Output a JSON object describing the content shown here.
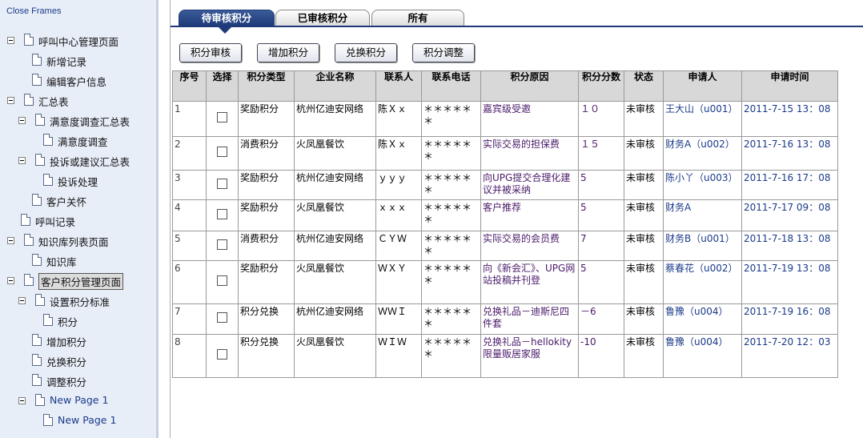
{
  "sidebar": {
    "close_frames": "Close Frames",
    "tree": [
      {
        "label": "呼叫中心管理页面",
        "level": 0,
        "toggle": true,
        "color": "black"
      },
      {
        "label": "新增记录",
        "level": 1,
        "toggle": false,
        "color": "black"
      },
      {
        "label": "编辑客户信息",
        "level": 1,
        "toggle": false,
        "color": "black"
      },
      {
        "label": "汇总表",
        "level": 0,
        "toggle": true,
        "color": "black"
      },
      {
        "label": "满意度调查汇总表",
        "level": 1,
        "toggle": true,
        "color": "black"
      },
      {
        "label": "满意度调查",
        "level": 2,
        "toggle": false,
        "color": "black"
      },
      {
        "label": "投诉或建议汇总表",
        "level": 1,
        "toggle": true,
        "color": "black"
      },
      {
        "label": "投诉处理",
        "level": 2,
        "toggle": false,
        "color": "black"
      },
      {
        "label": "客户关怀",
        "level": 1,
        "toggle": false,
        "color": "black"
      },
      {
        "label": "呼叫记录",
        "level": 0.5,
        "toggle": false,
        "color": "black"
      },
      {
        "label": "知识库列表页面",
        "level": 0,
        "toggle": true,
        "color": "black"
      },
      {
        "label": "知识库",
        "level": 1,
        "toggle": false,
        "color": "black"
      },
      {
        "label": "客户积分管理页面",
        "level": 0,
        "toggle": true,
        "color": "black",
        "selected": true
      },
      {
        "label": "设置积分标准",
        "level": 1,
        "toggle": true,
        "color": "black"
      },
      {
        "label": "积分",
        "level": 2,
        "toggle": false,
        "color": "black"
      },
      {
        "label": "增加积分",
        "level": 1,
        "toggle": false,
        "color": "black"
      },
      {
        "label": "兑换积分",
        "level": 1,
        "toggle": false,
        "color": "black"
      },
      {
        "label": "调整积分",
        "level": 1,
        "toggle": false,
        "color": "black"
      },
      {
        "label": "New Page 1",
        "level": 1,
        "toggle": true,
        "color": "blue"
      },
      {
        "label": "New Page 1",
        "level": 2,
        "toggle": false,
        "color": "blue"
      }
    ]
  },
  "tabs": [
    {
      "label": "待审核积分",
      "active": true
    },
    {
      "label": "已审核积分",
      "active": false
    },
    {
      "label": "所有",
      "active": false
    }
  ],
  "buttons": [
    "积分审核",
    "增加积分",
    "兑换积分",
    "积分调整"
  ],
  "table": {
    "headers": [
      "序号",
      "选择",
      "积分类型",
      "企业名称",
      "联系人",
      "联系电话",
      "积分原因",
      "积分分数",
      "状态",
      "申请人",
      "申请时间"
    ],
    "rows": [
      {
        "idx": "1",
        "type": "奖励积分",
        "company": "杭州亿迪安网络",
        "contact": "陈Ｘｘ",
        "phone": "＊＊＊＊＊＊",
        "reason": "嘉宾级受邀",
        "score": "１０",
        "status": "未审核",
        "applicant": "王大山（u001）",
        "time": "2011-7-15 13：08"
      },
      {
        "idx": "2",
        "type": "消费积分",
        "company": "火凤凰餐饮",
        "contact": "陈Ｘｘ",
        "phone": "＊＊＊＊＊＊",
        "reason": "实际交易的担保费",
        "score": "１５",
        "status": "未审核",
        "applicant": "财务A（u002）",
        "time": "2011-7-16 13：08"
      },
      {
        "idx": "3",
        "type": "奖励积分",
        "company": "杭州亿迪安网络",
        "contact": "ｙｙｙ",
        "phone": "＊＊＊＊＊＊",
        "reason": "向UPG提交合理化建议并被采纳",
        "score": "5",
        "status": "未审核",
        "applicant": "陈小丫（u003）",
        "time": "2011-7-16 17：08"
      },
      {
        "idx": "4",
        "type": "奖励积分",
        "company": "火凤凰餐饮",
        "contact": "ｘｘｘ",
        "phone": "＊＊＊＊＊＊",
        "reason": "客户推荐",
        "score": "5",
        "status": "未审核",
        "applicant": "财务A",
        "time": "2011-7-17 09：08"
      },
      {
        "idx": "5",
        "type": "消费积分",
        "company": "杭州亿迪安网络",
        "contact": "ＣＹＷ",
        "phone": "＊＊＊＊＊＊",
        "reason": "实际交易的会员费",
        "score": "7",
        "status": "未审核",
        "applicant": "财务B（u001）",
        "time": "2011-7-18 13：08"
      },
      {
        "idx": "6",
        "type": "奖励积分",
        "company": "火凤凰餐饮",
        "contact": "ＷＸＹ",
        "phone": "＊＊＊＊＊＊",
        "reason": "向《新会汇》、UPG网站投稿并刊登",
        "score": "5",
        "status": "未审核",
        "applicant": "蔡春花（u002）",
        "time": "2011-7-19 13：08"
      },
      {
        "idx": "7",
        "type": "积分兑换",
        "company": "杭州亿迪安网络",
        "contact": "ＷＷＩ",
        "phone": "＊＊＊＊＊＊",
        "reason": "兑换礼品－迪斯尼四件套",
        "score": "－6",
        "status": "未审核",
        "applicant": "鲁豫（u004）",
        "time": "2011-7-19 16：08"
      },
      {
        "idx": "8",
        "type": "积分兑换",
        "company": "火凤凰餐饮",
        "contact": "ＷＩＷ",
        "phone": "＊＊＊＊＊＊",
        "reason": "兑换礼品－hellokity限量贩居家服",
        "score": "-10",
        "status": "未审核",
        "applicant": "鲁豫（u004）",
        "time": "2011-7-20 12：03"
      }
    ]
  }
}
